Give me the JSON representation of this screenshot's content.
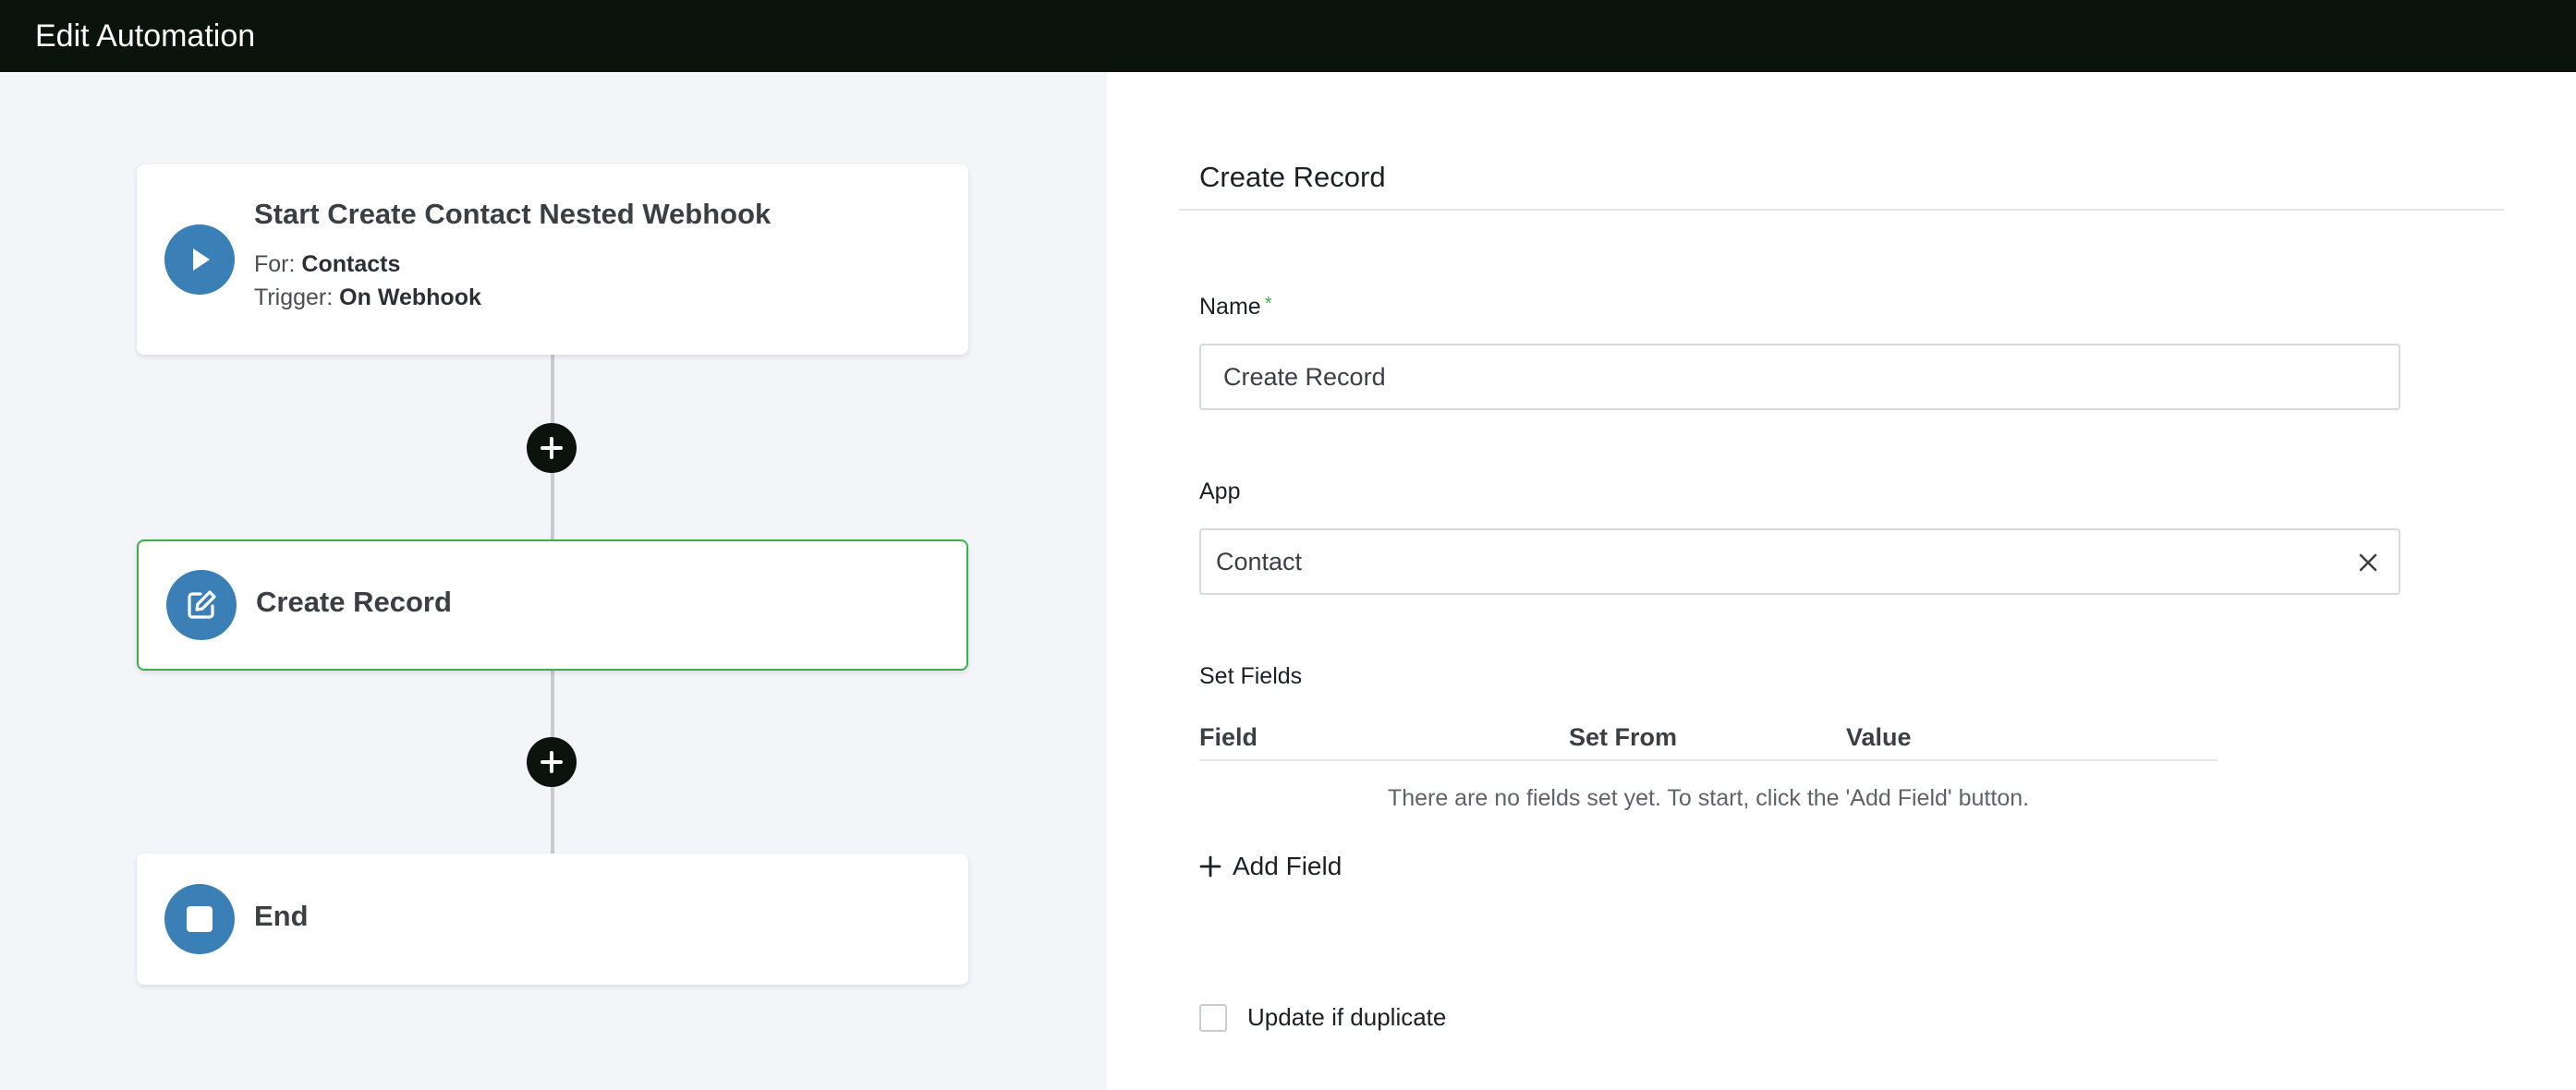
{
  "header": {
    "title": "Edit Automation"
  },
  "workflow": {
    "start": {
      "title": "Start Create Contact Nested Webhook",
      "for_label": "For:",
      "for_value": "Contacts",
      "trigger_label": "Trigger:",
      "trigger_value": "On Webhook",
      "icon": "play-icon"
    },
    "step": {
      "title": "Create Record",
      "icon": "edit-icon",
      "selected": true
    },
    "end": {
      "title": "End",
      "icon": "stop-icon"
    },
    "add_step_icon": "plus-icon"
  },
  "panel": {
    "title": "Create Record",
    "name_label": "Name",
    "name_required_mark": "*",
    "name_value": "Create Record",
    "app_label": "App",
    "app_value": "Contact",
    "set_fields_label": "Set Fields",
    "columns": [
      "Field",
      "Set From",
      "Value"
    ],
    "empty_message": "There are no fields set yet. To start, click the 'Add Field' button.",
    "add_field_label": "Add Field",
    "update_duplicate_label": "Update if duplicate",
    "update_duplicate_checked": false
  },
  "colors": {
    "topbar": "#0b140c",
    "badge": "#3a7fb6",
    "selected_border": "#3fae4a",
    "canvas": "#f3f5f9"
  }
}
